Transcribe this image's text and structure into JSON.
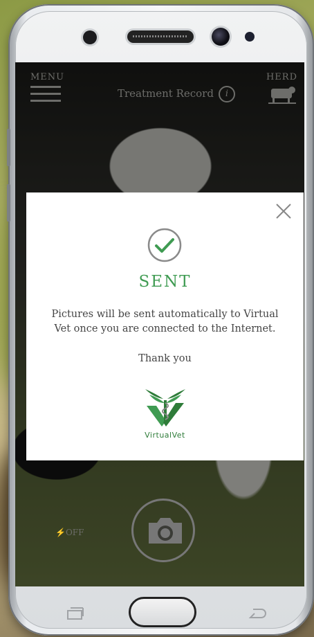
{
  "header": {
    "menu_label": "MENU",
    "title": "Treatment Record",
    "herd_label": "HERD",
    "info_icon": "i"
  },
  "camera": {
    "flash_label": "OFF"
  },
  "dialog": {
    "status_title": "SENT",
    "message": "Pictures will be sent automatically to Virtual Vet once you are connected to the Internet.",
    "thanks": "Thank you",
    "logo_text": "VirtualVet",
    "accent_color": "#3f9b52"
  }
}
